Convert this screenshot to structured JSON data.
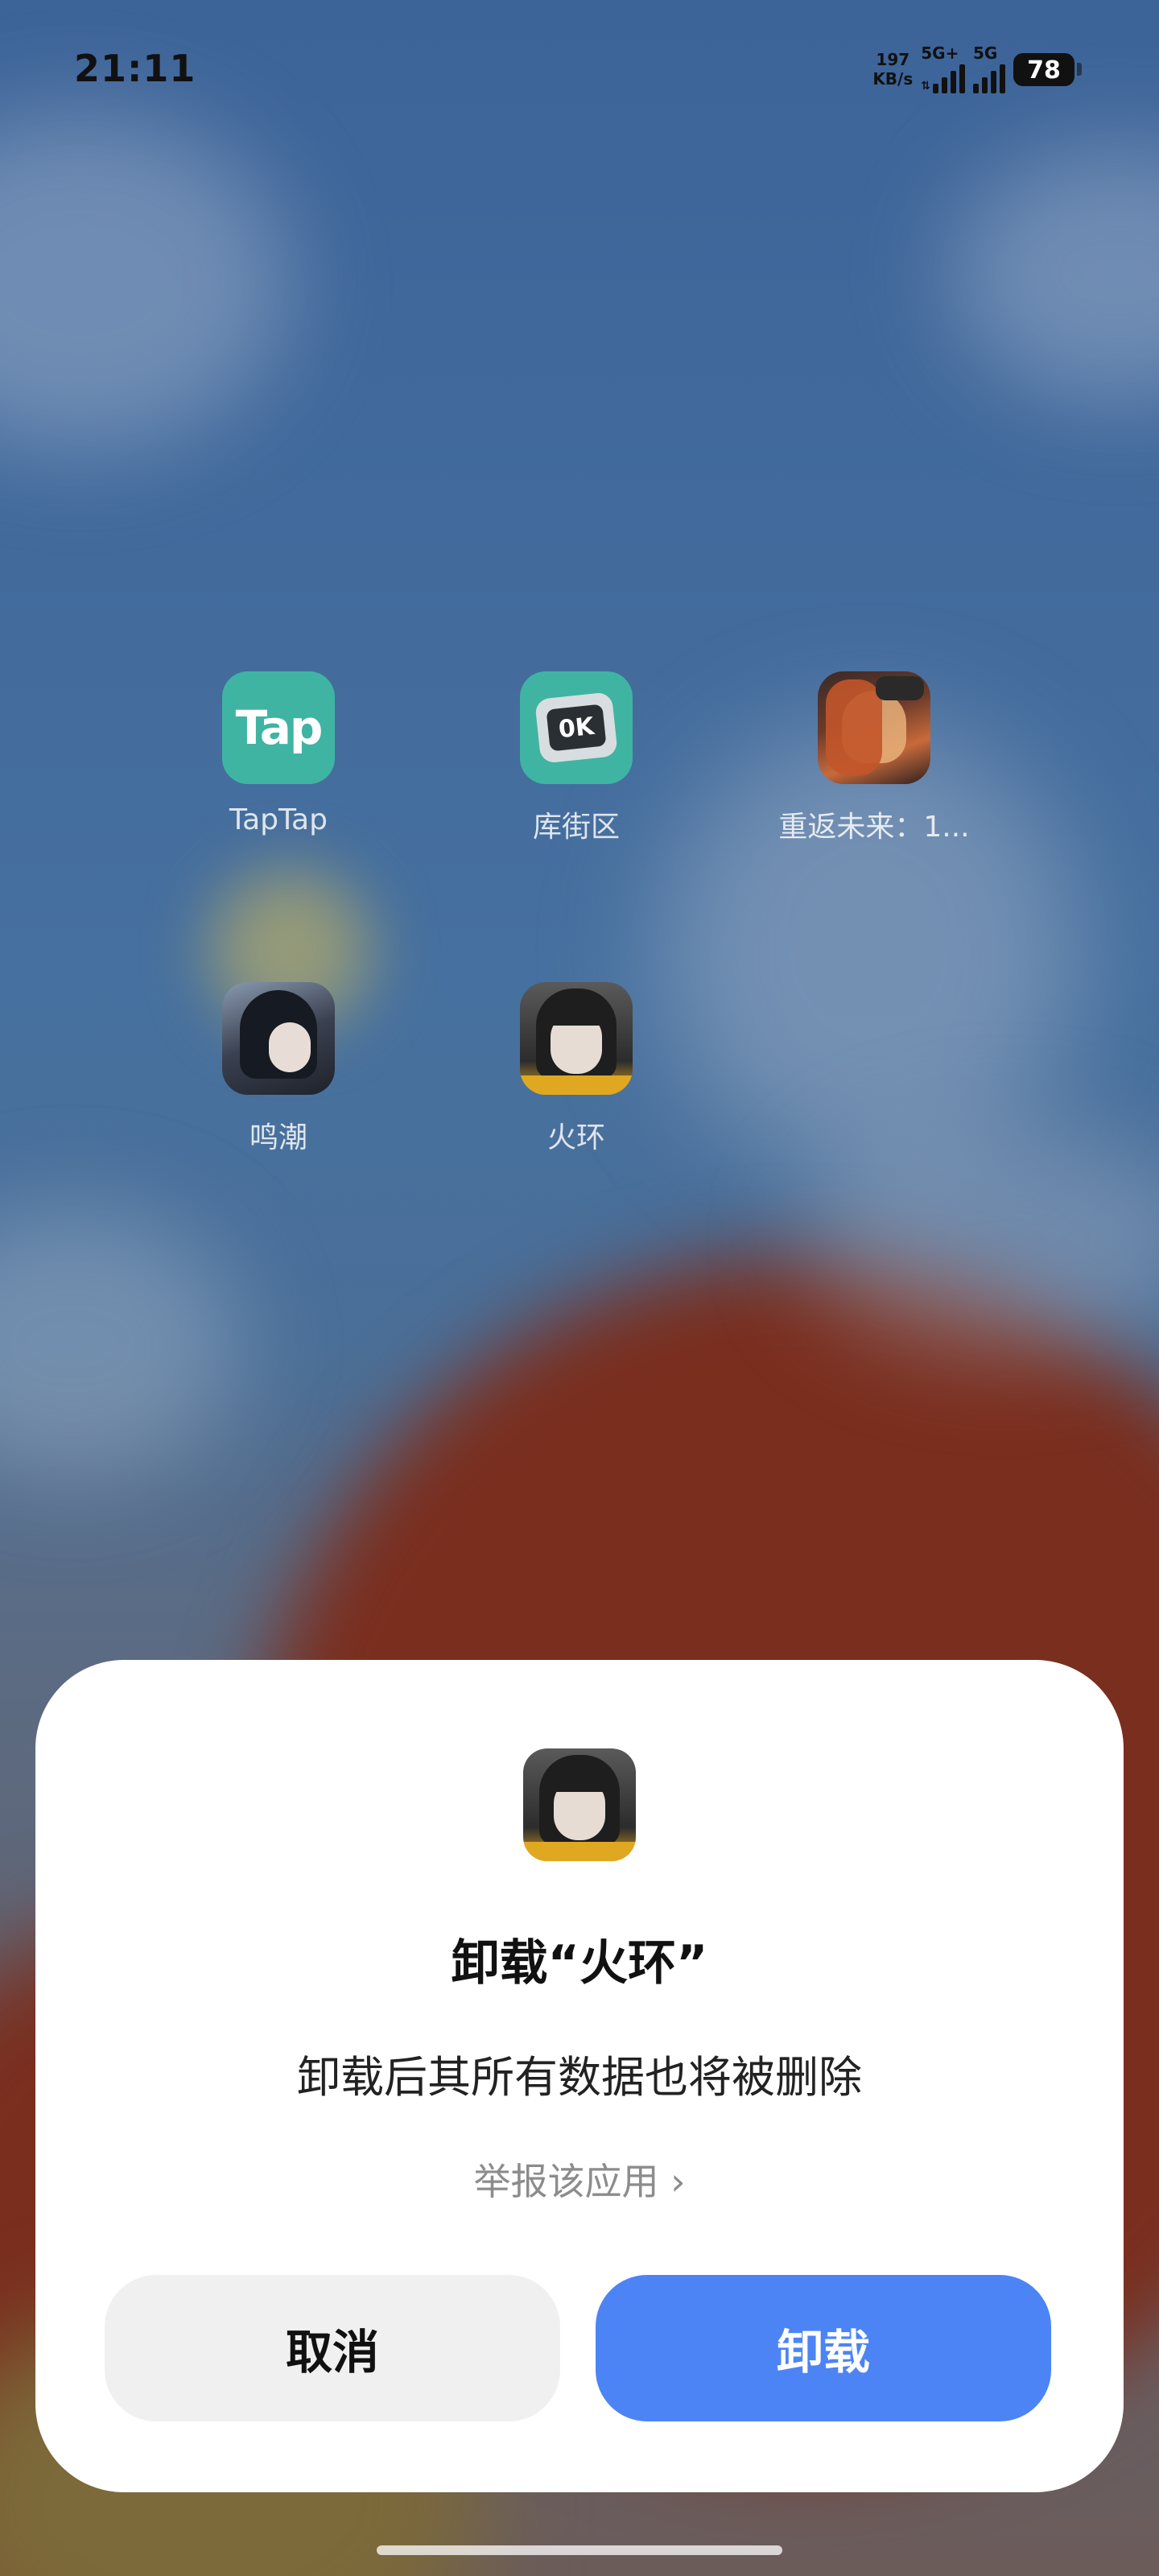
{
  "status_bar": {
    "time": "21:11",
    "speed_value": "197",
    "speed_unit": "KB/s",
    "sim1": "5G+",
    "sim2": "5G",
    "battery": "78"
  },
  "home": {
    "apps": [
      {
        "label": "TapTap",
        "icon": "taptap-icon",
        "icon_text": "Tap"
      },
      {
        "label": "库街区",
        "icon": "kujiequ-icon",
        "icon_text": "0K"
      },
      {
        "label": "重返未来：1...",
        "icon": "reverse1999-icon"
      },
      {
        "label": "鸣潮",
        "icon": "wuthering-waves-icon"
      },
      {
        "label": "火环",
        "icon": "huohuan-icon"
      }
    ]
  },
  "dialog": {
    "title": "卸载“火环”",
    "message": "卸载后其所有数据也将被删除",
    "report_link": "举报该应用 ›",
    "cancel_label": "取消",
    "confirm_label": "卸载",
    "confirm_color": "#4c84f5"
  }
}
